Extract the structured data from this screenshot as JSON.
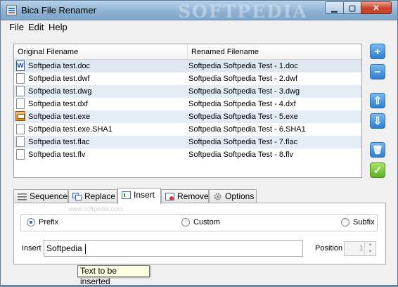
{
  "window": {
    "title": "Bica File Renamer",
    "watermark": "SOFTPEDIA"
  },
  "menu": {
    "items": [
      "File",
      "Edit",
      "Help"
    ]
  },
  "file_list": {
    "columns": [
      "Original Filename",
      "Renamed Filename"
    ],
    "rows": [
      {
        "original": "Softpedia test.doc",
        "renamed": "Softpedia Softpedia Test - 1.doc",
        "icon": "word-document-icon"
      },
      {
        "original": "Softpedia test.dwf",
        "renamed": "Softpedia Softpedia Test - 2.dwf",
        "icon": "file-icon"
      },
      {
        "original": "Softpedia test.dwg",
        "renamed": "Softpedia Softpedia Test - 3.dwg",
        "icon": "file-icon"
      },
      {
        "original": "Softpedia test.dxf",
        "renamed": "Softpedia Softpedia Test - 4.dxf",
        "icon": "file-icon"
      },
      {
        "original": "Softpedia test.exe",
        "renamed": "Softpedia Softpedia Test - 5.exe",
        "icon": "executable-icon"
      },
      {
        "original": "Softpedia test.exe.SHA1",
        "renamed": "Softpedia Softpedia Test - 6.SHA1",
        "icon": "file-icon"
      },
      {
        "original": "Softpedia test.flac",
        "renamed": "Softpedia Softpedia Test - 7.flac",
        "icon": "file-icon"
      },
      {
        "original": "Softpedia test.flv",
        "renamed": "Softpedia Softpedia Test - 8.flv",
        "icon": "file-icon"
      }
    ]
  },
  "side_buttons": {
    "add": "+",
    "remove": "−",
    "move_up": "⇧",
    "move_down": "⇩",
    "delete": "🗑",
    "apply": "✓"
  },
  "tabs": [
    {
      "label": "Sequence",
      "icon": "list-icon"
    },
    {
      "label": "Replace",
      "icon": "replace-icon"
    },
    {
      "label": "Insert",
      "icon": "insert-icon",
      "active": true
    },
    {
      "label": "Remove",
      "icon": "remove-icon"
    },
    {
      "label": "Options",
      "icon": "gear-icon"
    }
  ],
  "insert_panel": {
    "modes": [
      "Prefix",
      "Custom",
      "Subfix"
    ],
    "selected_mode": "Prefix",
    "insert_label": "Insert",
    "insert_value": "Softpedia",
    "position_label": "Position",
    "position_value": "1",
    "tooltip": "Text to be inserted"
  },
  "panel_watermark": "www.softpedia.com",
  "colors": {
    "accent": "#2d7fd0",
    "apply": "#5fb126",
    "titlebar": "#8fb2d3"
  }
}
